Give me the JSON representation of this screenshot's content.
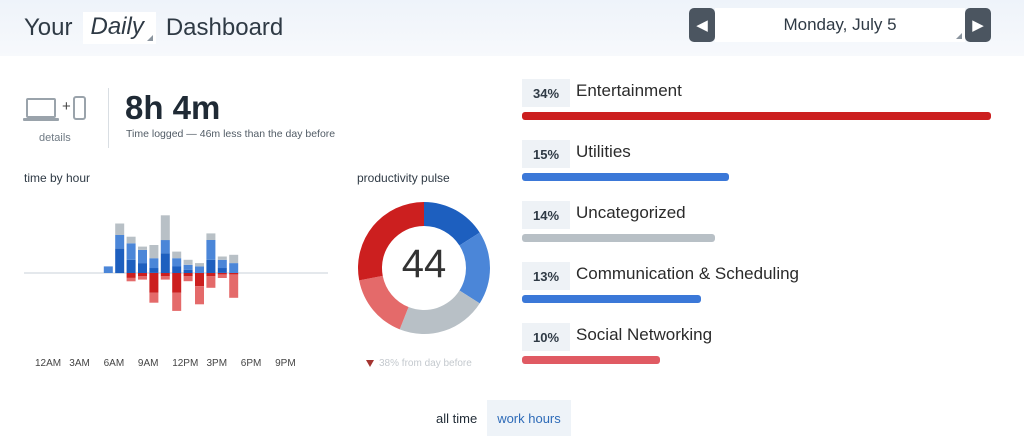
{
  "header": {
    "title_prefix": "Your",
    "period": "Daily",
    "title_suffix": "Dashboard",
    "date": "Monday, July 5",
    "prev_icon": "chevron-left-icon",
    "next_icon": "chevron-right-icon"
  },
  "summary": {
    "devices_label": "details",
    "devices_icons": [
      "laptop-icon",
      "plus-icon",
      "phone-icon"
    ],
    "total_time": "8h 4m",
    "subtitle": "Time logged — 46m less than the day before"
  },
  "hour_chart": {
    "title": "time by hour",
    "tick_labels": [
      "12AM",
      "3AM",
      "6AM",
      "9AM",
      "12PM",
      "3PM",
      "6PM",
      "9PM"
    ]
  },
  "chart_data": {
    "type": "bar",
    "title": "time by hour",
    "note": "stacked bars by hour; productive time above the baseline, distracting time below; values are minutes (estimated)",
    "categories": [
      "12AM",
      "1AM",
      "2AM",
      "3AM",
      "4AM",
      "5AM",
      "6AM",
      "7AM",
      "8AM",
      "9AM",
      "10AM",
      "11AM",
      "12PM",
      "1PM",
      "2PM",
      "3PM",
      "4PM",
      "5PM",
      "6PM",
      "7PM",
      "8PM",
      "9PM",
      "10PM",
      "11PM"
    ],
    "series": [
      {
        "name": "",
        "color": "#1d5fbf",
        "values": [
          0,
          0,
          0,
          0,
          0,
          0,
          0,
          0,
          15,
          8,
          6,
          3,
          12,
          4,
          2,
          0,
          8,
          3,
          0,
          0,
          0,
          0,
          0,
          0
        ]
      },
      {
        "name": "",
        "color": "#4b86d8",
        "values": [
          0,
          0,
          0,
          0,
          0,
          0,
          0,
          4,
          8,
          10,
          8,
          6,
          8,
          5,
          3,
          4,
          12,
          5,
          6,
          0,
          0,
          0,
          0,
          0
        ]
      },
      {
        "name": "",
        "color": "#b8c0c6",
        "values": [
          0,
          0,
          0,
          0,
          0,
          0,
          0,
          0,
          7,
          4,
          2,
          8,
          15,
          4,
          3,
          2,
          4,
          2,
          5,
          0,
          0,
          0,
          0,
          0
        ]
      },
      {
        "name": "",
        "color": "#cc1f1f",
        "values": [
          0,
          0,
          0,
          0,
          0,
          0,
          0,
          0,
          0,
          -3,
          -2,
          -12,
          -2,
          -12,
          -2,
          -8,
          -2,
          -1,
          -1,
          0,
          0,
          0,
          0,
          0
        ]
      },
      {
        "name": "",
        "color": "#e46a6a",
        "values": [
          0,
          0,
          0,
          0,
          0,
          0,
          0,
          0,
          0,
          -2,
          -2,
          -6,
          -2,
          -11,
          -3,
          -11,
          -7,
          -2,
          -14,
          0,
          0,
          0,
          0,
          0
        ]
      }
    ]
  },
  "pulse": {
    "title": "productivity pulse",
    "score": "44",
    "change": "38% from day before",
    "down_icon": "arrow-down-icon",
    "segments": [
      {
        "value": 16,
        "color": "#1d5fbf"
      },
      {
        "value": 18,
        "color": "#4b86d8"
      },
      {
        "value": 22,
        "color": "#b8c0c6"
      },
      {
        "value": 16,
        "color": "#e46a6a"
      },
      {
        "value": 28,
        "color": "#cc1f1f"
      }
    ]
  },
  "categories": [
    {
      "pct": "34%",
      "name": "Entertainment",
      "share": 34,
      "color": "#cc1f1f"
    },
    {
      "pct": "15%",
      "name": "Utilities",
      "share": 15,
      "color": "#3b78d8"
    },
    {
      "pct": "14%",
      "name": "Uncategorized",
      "share": 14,
      "color": "#b8c0c6"
    },
    {
      "pct": "13%",
      "name": "Communication & Scheduling",
      "share": 13,
      "color": "#3b78d8"
    },
    {
      "pct": "10%",
      "name": "Social Networking",
      "share": 10,
      "color": "#e05a63"
    }
  ],
  "toggle": {
    "all_time": "all time",
    "work_hours": "work hours"
  }
}
